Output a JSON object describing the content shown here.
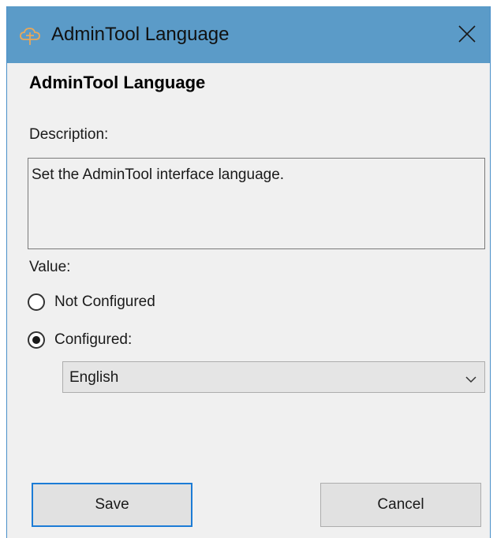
{
  "window": {
    "title": "AdminTool Language",
    "icon": "admintool-cloud-icon",
    "close_icon": "close-icon"
  },
  "dialog": {
    "heading": "AdminTool Language",
    "description_label": "Description:",
    "description_text": "Set the AdminTool interface language.",
    "value_label": "Value:",
    "options": [
      {
        "label": "Not Configured",
        "selected": false
      },
      {
        "label": "Configured:",
        "selected": true
      }
    ],
    "language_select": {
      "value": "English",
      "icon": "chevron-down-icon"
    }
  },
  "buttons": {
    "save_label": "Save",
    "cancel_label": "Cancel"
  },
  "colors": {
    "titlebar": "#5b9bc8",
    "background": "#f0f0f0",
    "focus_border": "#1c7cd6"
  }
}
